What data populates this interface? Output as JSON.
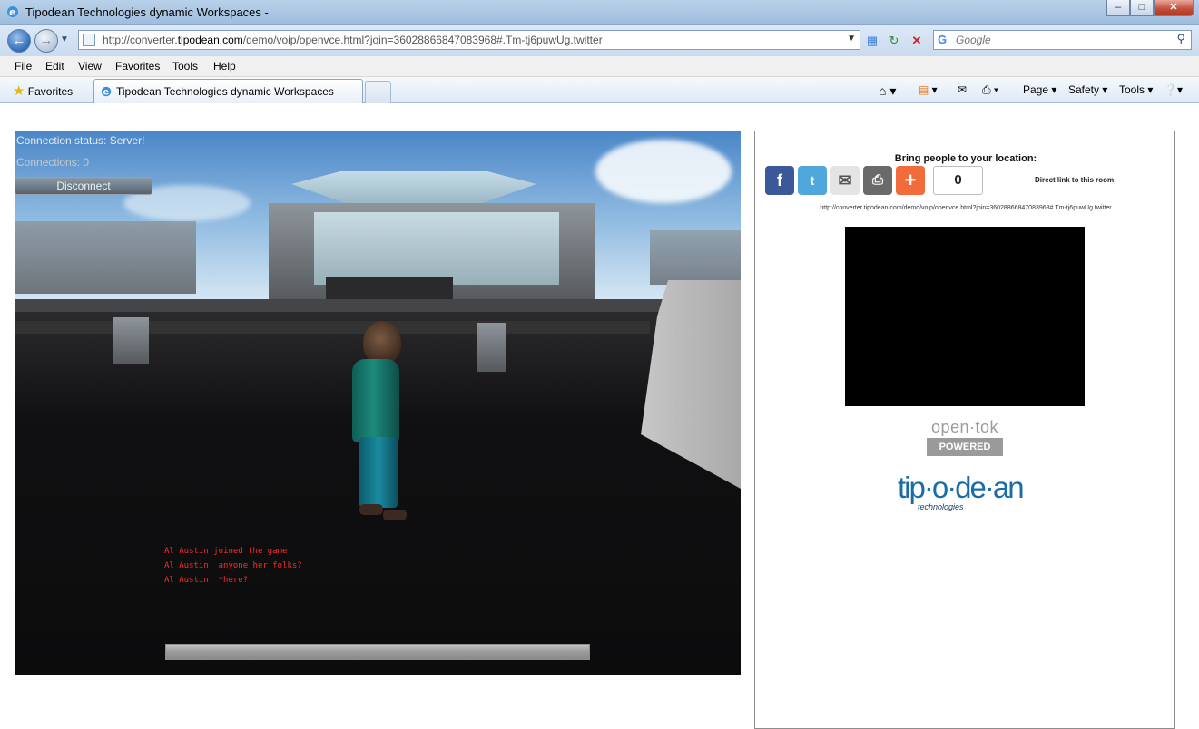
{
  "window": {
    "title": "Tipodean Technologies dynamic Workspaces -",
    "buttons": {
      "minimize": "–",
      "maximize": "□",
      "close": "✕"
    }
  },
  "address": {
    "url_prefix": "http://converter.",
    "url_domain": "tipodean.com",
    "url_path": "/demo/voip/openvce.html?join=36028866847083968#.Tm-tj6puwUg.twitter",
    "search_placeholder": "Google"
  },
  "menu": [
    "File",
    "Edit",
    "View",
    "Favorites",
    "Tools",
    "Help"
  ],
  "favorites_bar": {
    "favorites_label": "Favorites",
    "tab_title": "Tipodean Technologies dynamic Workspaces",
    "commands": [
      "Page ▾",
      "Safety ▾",
      "Tools ▾"
    ]
  },
  "game": {
    "connection_status": "Connection status: Server!",
    "connections": "Connections: 0",
    "disconnect_label": "Disconnect",
    "chat": [
      "Al Austin joined the game",
      "Al Austin: anyone her folks?",
      "Al Austin: *here?"
    ],
    "progress": 1.0
  },
  "side": {
    "bring_people": "Bring people to your location:",
    "share_count": "0",
    "direct_link_label": "Direct link to this room:",
    "room_url": "http://converter.tipodean.com/demo/voip/openvce.html?join=36028866847083968#.Tm-tj6puwUg.twitter",
    "opentok_text": "open·tok",
    "opentok_powered": "POWERED",
    "tipodean_logo": "tip·o·de·an",
    "tipodean_sub": "technologies"
  },
  "colors": {
    "chat_red": "#ff2a2a",
    "facebook": "#3b5998",
    "twitter": "#4fa7dc",
    "addthis": "#f26b3a",
    "tipodean_blue": "#1a6ca8"
  },
  "icons": [
    "ie-icon",
    "back-icon",
    "forward-icon",
    "page-icon",
    "compat-icon",
    "refresh-icon",
    "stop-icon",
    "google-icon",
    "search-icon",
    "star-icon",
    "home-icon",
    "rss-icon",
    "mail-icon",
    "print-icon",
    "help-icon",
    "facebook-icon",
    "twitter-icon",
    "email-icon",
    "printer-icon",
    "addthis-icon"
  ]
}
